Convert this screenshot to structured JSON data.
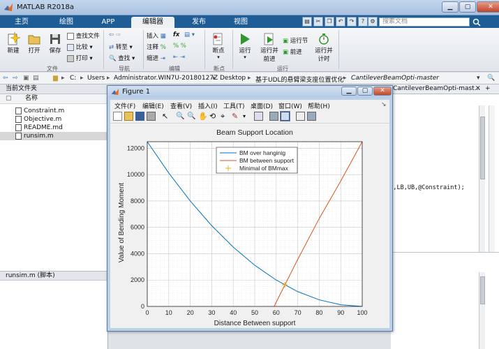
{
  "window": {
    "title": "MATLAB R2018a"
  },
  "tabs": [
    {
      "label": "主页"
    },
    {
      "label": "绘图"
    },
    {
      "label": "APP"
    },
    {
      "label": "编辑器"
    },
    {
      "label": "发布"
    },
    {
      "label": "视图"
    }
  ],
  "search": {
    "placeholder": "搜索文档"
  },
  "ribbon": {
    "new": "新建",
    "open": "打开",
    "save": "保存",
    "find_files": "查找文件",
    "compare": "比较",
    "print": "打印",
    "goto": "转至",
    "find": "查找",
    "insert": "插入",
    "comment": "注释",
    "indent": "缩进",
    "fx": "fx",
    "breakpoints": "断点",
    "run": "运行",
    "run_advance_1": "运行并",
    "run_advance_2": "前进",
    "run_section": "运行节",
    "advance": "前进",
    "run_time_1": "运行并",
    "run_time_2": "计时",
    "groups": {
      "file": "文件",
      "nav": "导航",
      "edit": "编辑",
      "bp": "断点",
      "run": "运行"
    }
  },
  "address": {
    "parts": [
      "C:",
      "Users",
      "Administrator.WIN7U-20180127Z",
      "Desktop",
      "基于UDL的悬臂梁支座位置优化",
      "CantileverBeamOpti-master"
    ]
  },
  "left_panel": {
    "title": "当前文件夹",
    "column": "名称",
    "files": [
      {
        "name": "Constraint.m"
      },
      {
        "name": "Objective.m"
      },
      {
        "name": "README.md"
      },
      {
        "name": "runsim.m"
      }
    ],
    "detail": "runsim.m  (脚本)"
  },
  "editor": {
    "tab": "CantileverBeamOpti-mast...",
    "line1": ")",
    "line2": ",[],LB,UB,@Constraint);"
  },
  "figure": {
    "title": "Figure 1",
    "menu": [
      "文件(F)",
      "编辑(E)",
      "查看(V)",
      "插入(I)",
      "工具(T)",
      "桌面(D)",
      "窗口(W)",
      "帮助(H)"
    ]
  },
  "chart_data": {
    "type": "line",
    "title": "Beam Support Location",
    "xlabel": "Distance Between support",
    "ylabel": "Value of Bending Moment",
    "xlim": [
      0,
      100
    ],
    "ylim": [
      0,
      12500
    ],
    "xticks": [
      0,
      10,
      20,
      30,
      40,
      50,
      60,
      70,
      80,
      90,
      100
    ],
    "yticks": [
      0,
      2000,
      4000,
      6000,
      8000,
      10000,
      12000
    ],
    "grid": true,
    "legend_position": "top-center",
    "series": [
      {
        "name": "BM over hanginig",
        "color": "#0072BD",
        "x": [
          0,
          10,
          20,
          30,
          40,
          50,
          60,
          70,
          80,
          90,
          100
        ],
        "y": [
          12500,
          10125,
          8000,
          6125,
          4500,
          3125,
          2000,
          1125,
          500,
          125,
          0
        ]
      },
      {
        "name": "BM between support",
        "color": "#D95319",
        "x": [
          59,
          70,
          80,
          90,
          100
        ],
        "y": [
          0,
          3570,
          6670,
          9510,
          12500
        ]
      },
      {
        "name": "Minimal of BMmax",
        "color": "#EDB120",
        "marker": "+",
        "x": [
          64
        ],
        "y": [
          1640
        ]
      }
    ]
  }
}
